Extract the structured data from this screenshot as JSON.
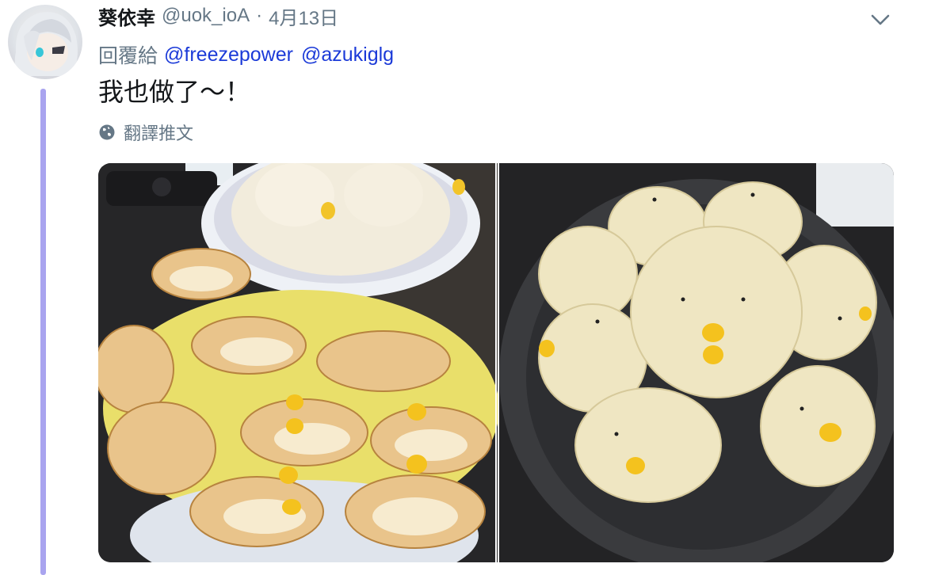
{
  "tweet": {
    "author_name": "葵依幸",
    "author_handle": "@uok_ioA",
    "separator": "·",
    "date": "4月13日",
    "replying_label": "回覆給",
    "mentions": [
      "@freezepower",
      "@azukiglg"
    ],
    "text": "我也做了～！",
    "translate_label": "翻譯推文"
  },
  "icons": {
    "caret": "chevron-down-icon",
    "globe": "globe-icon"
  },
  "colors": {
    "link": "#1b3ad8",
    "secondary_text": "#657786",
    "thread_line": "#a9a4ef"
  }
}
